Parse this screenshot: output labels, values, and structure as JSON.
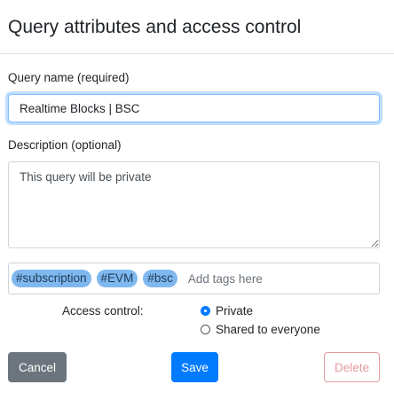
{
  "dialog": {
    "title": "Query attributes and access control"
  },
  "form": {
    "name_label": "Query name (required)",
    "name_value": "Realtime Blocks | BSC",
    "description_label": "Description (optional)",
    "description_value": "This query will be private",
    "tags": [
      "#subscription",
      "#EVM",
      "#bsc"
    ],
    "tags_placeholder": "Add tags here",
    "access_label": "Access control:",
    "access_options": [
      {
        "label": "Private",
        "selected": true
      },
      {
        "label": "Shared to everyone",
        "selected": false
      }
    ]
  },
  "buttons": {
    "cancel": "Cancel",
    "save": "Save",
    "delete": "Delete"
  },
  "colors": {
    "primary": "#007bff",
    "secondary": "#6c757d",
    "danger_faded": "#e49aa1",
    "tag_bg": "#7fb8ef"
  }
}
